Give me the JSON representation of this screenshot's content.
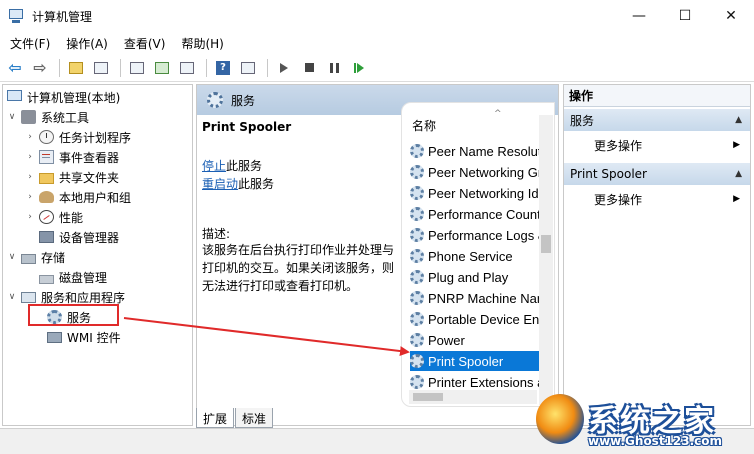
{
  "window": {
    "title": "计算机管理",
    "minimize_glyph": "—",
    "maximize_glyph": "☐",
    "close_glyph": "✕"
  },
  "menu": {
    "file": "文件(F)",
    "action": "操作(A)",
    "view": "查看(V)",
    "help": "帮助(H)"
  },
  "toolbar": {
    "back_glyph": "⇦",
    "forward_glyph": "⇨",
    "help_glyph": "?"
  },
  "tree": {
    "root": "计算机管理(本地)",
    "system_tools": "系统工具",
    "task_scheduler": "任务计划程序",
    "event_viewer": "事件查看器",
    "shared_folders": "共享文件夹",
    "local_users": "本地用户和组",
    "performance": "性能",
    "device_manager": "设备管理器",
    "storage": "存储",
    "disk_management": "磁盘管理",
    "services_apps": "服务和应用程序",
    "services": "服务",
    "wmi": "WMI 控件",
    "expanded_glyph": "∨",
    "collapsed_glyph": "›"
  },
  "services_panel": {
    "header": "服务",
    "selected_title": "Print Spooler",
    "stop_link": "停止",
    "stop_suffix": "此服务",
    "restart_link": "重启动",
    "restart_suffix": "此服务",
    "desc_label": "描述:",
    "desc_text": "该服务在后台执行打印作业并处理与打印机的交互。如果关闭该服务，则无法进行打印或查看打印机。",
    "column_name": "名称",
    "sort_glyph": "^",
    "rows": [
      "Peer Name Resolution Protocol",
      "Peer Networking Grouping",
      "Peer Networking Identity Manager",
      "Performance Counter DLL Host",
      "Performance Logs & Alerts",
      "Phone Service",
      "Plug and Play",
      "PNRP Machine Name Publication Service",
      "Portable Device Enumerator Service",
      "Power",
      "Print Spooler",
      "Printer Extensions and Notifications"
    ],
    "selected_index": 10
  },
  "tabs": {
    "extended": "扩展",
    "standard": "标准"
  },
  "actions": {
    "title": "操作",
    "section1": "服务",
    "more1": "更多操作",
    "section2": "Print Spooler",
    "more2": "更多操作",
    "caret_glyph": "▲",
    "submenu_glyph": "▶"
  },
  "watermark": {
    "title": "系统之家",
    "url": "www.Ghost123.com"
  },
  "colors": {
    "selection": "#0a78d7",
    "annotation": "#e02a2a",
    "link": "#1a5fb4"
  }
}
